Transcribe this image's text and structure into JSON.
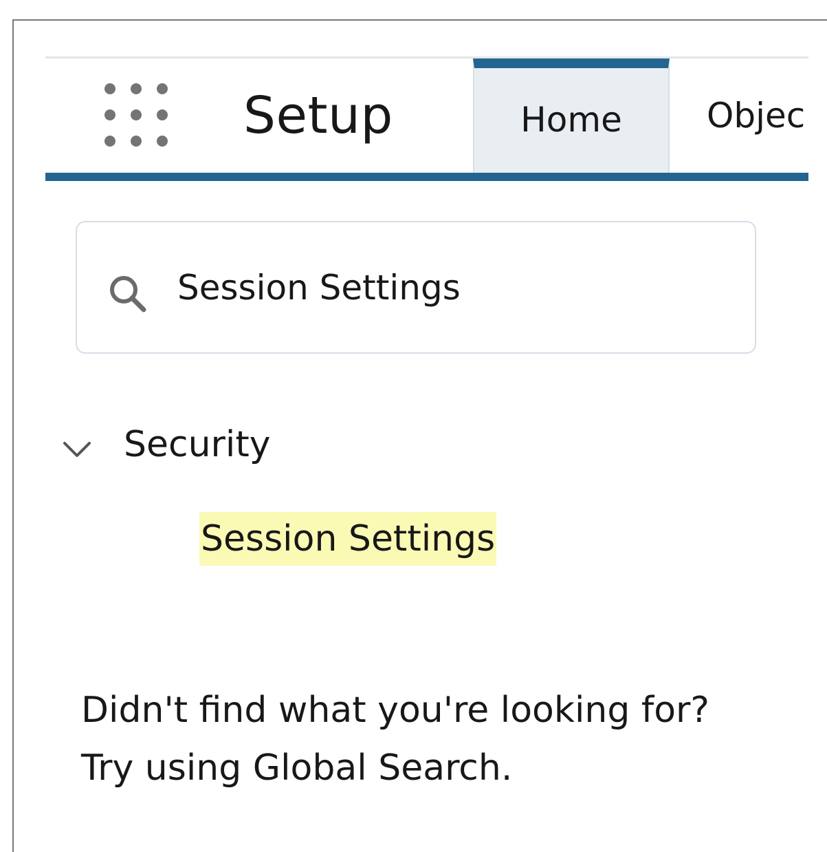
{
  "header": {
    "app_launcher_icon": "app-launcher-grid-icon",
    "app_name": "Setup",
    "tabs": [
      {
        "label": "Home",
        "active": true
      },
      {
        "label": "Objec",
        "active": false
      }
    ],
    "accent_color": "#236591"
  },
  "search": {
    "icon": "search-icon",
    "value": "Session Settings"
  },
  "results": {
    "group": {
      "icon": "chevron-down-icon",
      "label": "Security"
    },
    "items": [
      {
        "label": "Session Settings",
        "highlight_color": "#fafab4"
      }
    ]
  },
  "help": {
    "line1": "Didn't find what you're looking for?",
    "line2": "Try using Global Search."
  }
}
